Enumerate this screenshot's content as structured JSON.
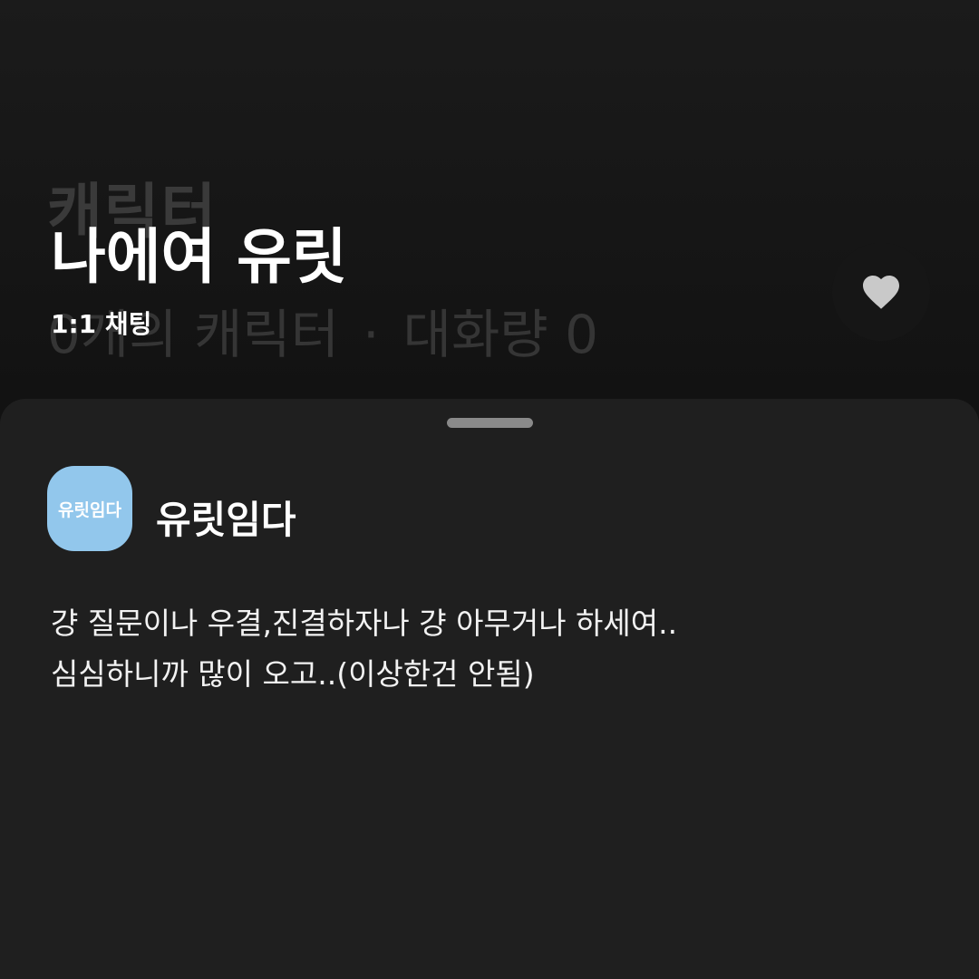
{
  "background": {
    "title": "캐릭터",
    "stats_count": "0개의 캐릭터",
    "stats_separator": "·",
    "stats_volume": "대화량 0"
  },
  "header": {
    "title": "나에여 유릿",
    "chat_type": "1:1 채팅",
    "like_icon": "heart-icon"
  },
  "sheet": {
    "creator": {
      "avatar_text": "유릿임다",
      "avatar_color": "#92c7ec",
      "name": "유릿임다"
    },
    "description_lines": [
      "걍 질문이나 우결,진결하자나 걍 아무거나 하세여..",
      "심심하니까 많이 오고..(이상한건 안됨)"
    ]
  }
}
